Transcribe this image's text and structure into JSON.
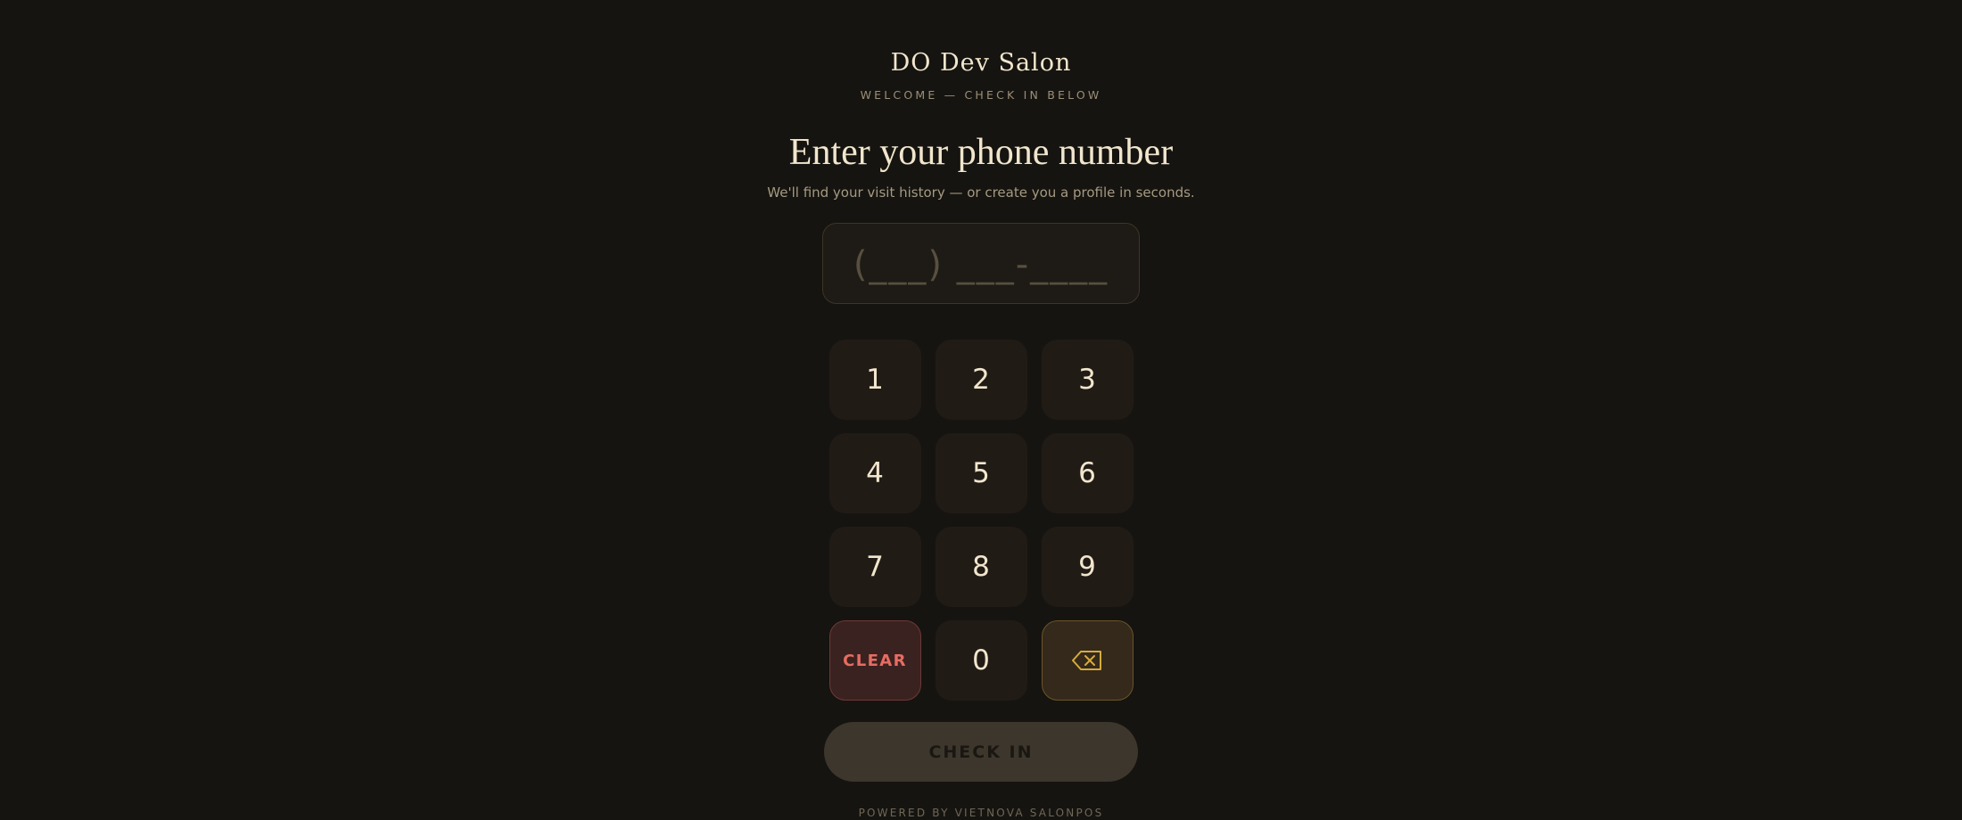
{
  "header": {
    "salon_name": "DO Dev Salon",
    "welcome": "WELCOME — CHECK IN BELOW"
  },
  "main": {
    "heading": "Enter your phone number",
    "subheading": "We'll find your visit history — or create you a profile in seconds.",
    "phone_placeholder": "(___) ___-____"
  },
  "keypad": {
    "k1": "1",
    "k2": "2",
    "k3": "3",
    "k4": "4",
    "k5": "5",
    "k6": "6",
    "k7": "7",
    "k8": "8",
    "k9": "9",
    "clear": "CLEAR",
    "k0": "0",
    "backspace_icon": "backspace-icon"
  },
  "actions": {
    "check_in": "CHECK IN"
  },
  "footer": {
    "powered_by": "POWERED BY VIETNOVA SALONPOS"
  },
  "colors": {
    "background": "#161410",
    "clear_accent": "#e66d62",
    "backspace_accent": "#d6ab3e",
    "text_primary": "#f1e6cd"
  }
}
